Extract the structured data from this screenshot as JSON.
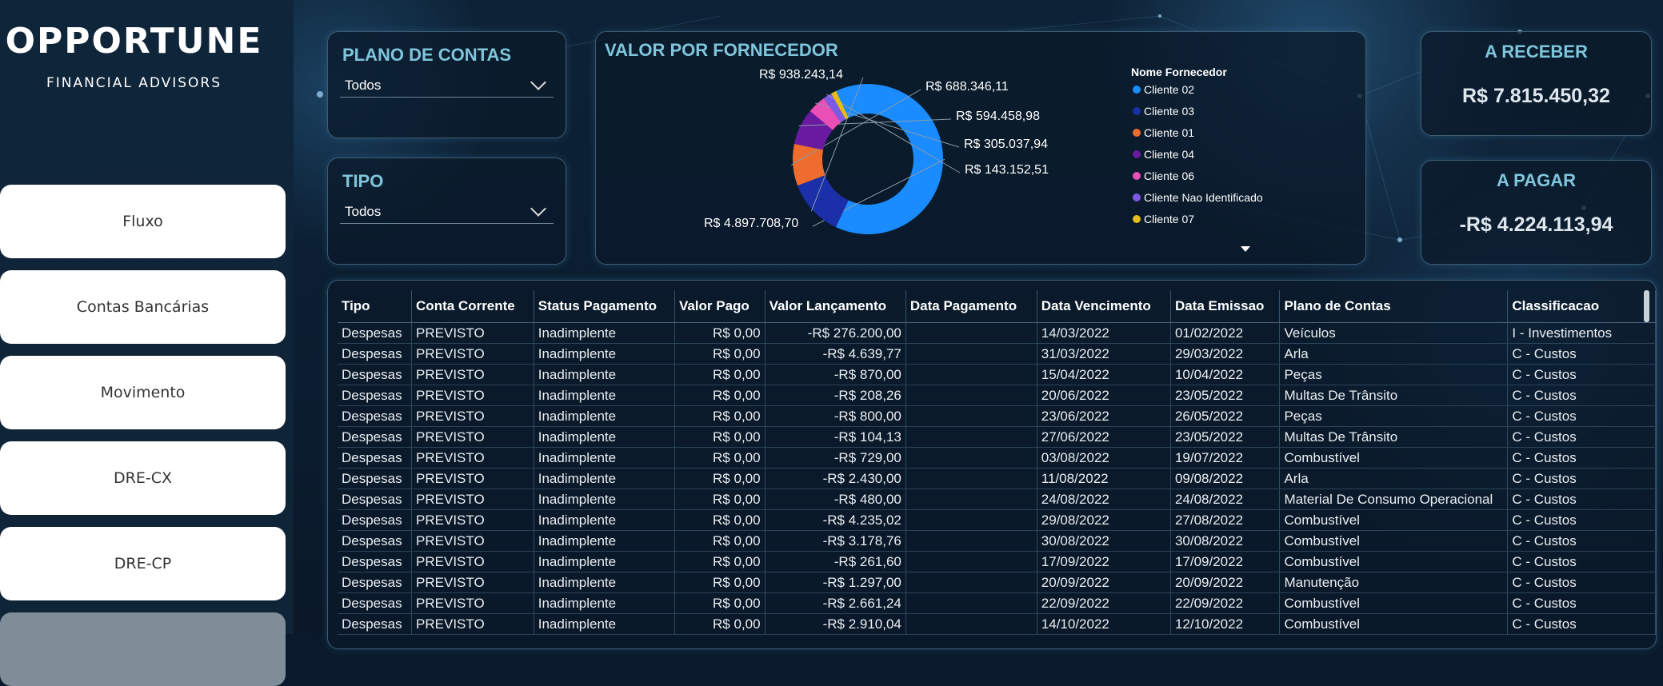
{
  "brand": {
    "name": "OPPORTUNE",
    "tagline": "FINANCIAL ADVISORS"
  },
  "nav": [
    {
      "label": "Fluxo"
    },
    {
      "label": "Contas Bancárias"
    },
    {
      "label": "Movimento"
    },
    {
      "label": "DRE-CX"
    },
    {
      "label": "DRE-CP"
    },
    {
      "label": ""
    }
  ],
  "filters": {
    "plano": {
      "title": "PLANO DE CONTAS",
      "value": "Todos"
    },
    "tipo": {
      "title": "TIPO",
      "value": "Todos"
    }
  },
  "chart": {
    "title": "VALOR POR FORNECEDOR",
    "legend_title": "Nome Fornecedor"
  },
  "chart_data": {
    "type": "pie",
    "title": "VALOR POR FORNECEDOR",
    "legend_title": "Nome Fornecedor",
    "legend_position": "right",
    "categories": [
      "Cliente 02",
      "Cliente 03",
      "Cliente 01",
      "Cliente 04",
      "Cliente 06",
      "Cliente Nao Identificado",
      "Cliente 07"
    ],
    "colors": [
      "#1a8cff",
      "#1a2fa8",
      "#ee6d2e",
      "#6a1aa0",
      "#e94fb5",
      "#7b5be6",
      "#e6bc1a"
    ],
    "values": [
      4897708.7,
      938243.14,
      688346.11,
      594458.98,
      305037.94,
      143152.51,
      90000
    ],
    "labels": [
      "R$ 4.897.708,70",
      "R$ 938.243,14",
      "R$ 688.346,11",
      "R$ 594.458,98",
      "R$ 305.037,94",
      "R$ 143.152,51",
      ""
    ]
  },
  "kpis": {
    "receber": {
      "title": "A RECEBER",
      "value": "R$ 7.815.450,32"
    },
    "pagar": {
      "title": "A PAGAR",
      "value": "-R$ 4.224.113,94"
    }
  },
  "table": {
    "columns": [
      "Tipo",
      "Conta Corrente",
      "Status Pagamento",
      "Valor Pago",
      "Valor Lançamento",
      "Data Pagamento",
      "Data Vencimento",
      "Data Emissao",
      "Plano de Contas",
      "Classificacao"
    ],
    "rows": [
      [
        "Despesas",
        "PREVISTO",
        "Inadimplente",
        "R$ 0,00",
        "-R$ 276.200,00",
        "",
        "14/03/2022",
        "01/02/2022",
        "Veículos",
        "I - Investimentos"
      ],
      [
        "Despesas",
        "PREVISTO",
        "Inadimplente",
        "R$ 0,00",
        "-R$ 4.639,77",
        "",
        "31/03/2022",
        "29/03/2022",
        "Arla",
        "C - Custos"
      ],
      [
        "Despesas",
        "PREVISTO",
        "Inadimplente",
        "R$ 0,00",
        "-R$ 870,00",
        "",
        "15/04/2022",
        "10/04/2022",
        "Peças",
        "C - Custos"
      ],
      [
        "Despesas",
        "PREVISTO",
        "Inadimplente",
        "R$ 0,00",
        "-R$ 208,26",
        "",
        "20/06/2022",
        "23/05/2022",
        "Multas De Trânsito",
        "C - Custos"
      ],
      [
        "Despesas",
        "PREVISTO",
        "Inadimplente",
        "R$ 0,00",
        "-R$ 800,00",
        "",
        "23/06/2022",
        "26/05/2022",
        "Peças",
        "C - Custos"
      ],
      [
        "Despesas",
        "PREVISTO",
        "Inadimplente",
        "R$ 0,00",
        "-R$ 104,13",
        "",
        "27/06/2022",
        "23/05/2022",
        "Multas De Trânsito",
        "C - Custos"
      ],
      [
        "Despesas",
        "PREVISTO",
        "Inadimplente",
        "R$ 0,00",
        "-R$ 729,00",
        "",
        "03/08/2022",
        "19/07/2022",
        "Combustível",
        "C - Custos"
      ],
      [
        "Despesas",
        "PREVISTO",
        "Inadimplente",
        "R$ 0,00",
        "-R$ 2.430,00",
        "",
        "11/08/2022",
        "09/08/2022",
        "Arla",
        "C - Custos"
      ],
      [
        "Despesas",
        "PREVISTO",
        "Inadimplente",
        "R$ 0,00",
        "-R$ 480,00",
        "",
        "24/08/2022",
        "24/08/2022",
        "Material De Consumo Operacional",
        "C - Custos"
      ],
      [
        "Despesas",
        "PREVISTO",
        "Inadimplente",
        "R$ 0,00",
        "-R$ 4.235,02",
        "",
        "29/08/2022",
        "27/08/2022",
        "Combustível",
        "C - Custos"
      ],
      [
        "Despesas",
        "PREVISTO",
        "Inadimplente",
        "R$ 0,00",
        "-R$ 3.178,76",
        "",
        "30/08/2022",
        "30/08/2022",
        "Combustível",
        "C - Custos"
      ],
      [
        "Despesas",
        "PREVISTO",
        "Inadimplente",
        "R$ 0,00",
        "-R$ 261,60",
        "",
        "17/09/2022",
        "17/09/2022",
        "Combustível",
        "C - Custos"
      ],
      [
        "Despesas",
        "PREVISTO",
        "Inadimplente",
        "R$ 0,00",
        "-R$ 1.297,00",
        "",
        "20/09/2022",
        "20/09/2022",
        "Manutenção",
        "C - Custos"
      ],
      [
        "Despesas",
        "PREVISTO",
        "Inadimplente",
        "R$ 0,00",
        "-R$ 2.661,24",
        "",
        "22/09/2022",
        "22/09/2022",
        "Combustível",
        "C - Custos"
      ],
      [
        "Despesas",
        "PREVISTO",
        "Inadimplente",
        "R$ 0,00",
        "-R$ 2.910,04",
        "",
        "14/10/2022",
        "12/10/2022",
        "Combustível",
        "C - Custos"
      ]
    ]
  }
}
